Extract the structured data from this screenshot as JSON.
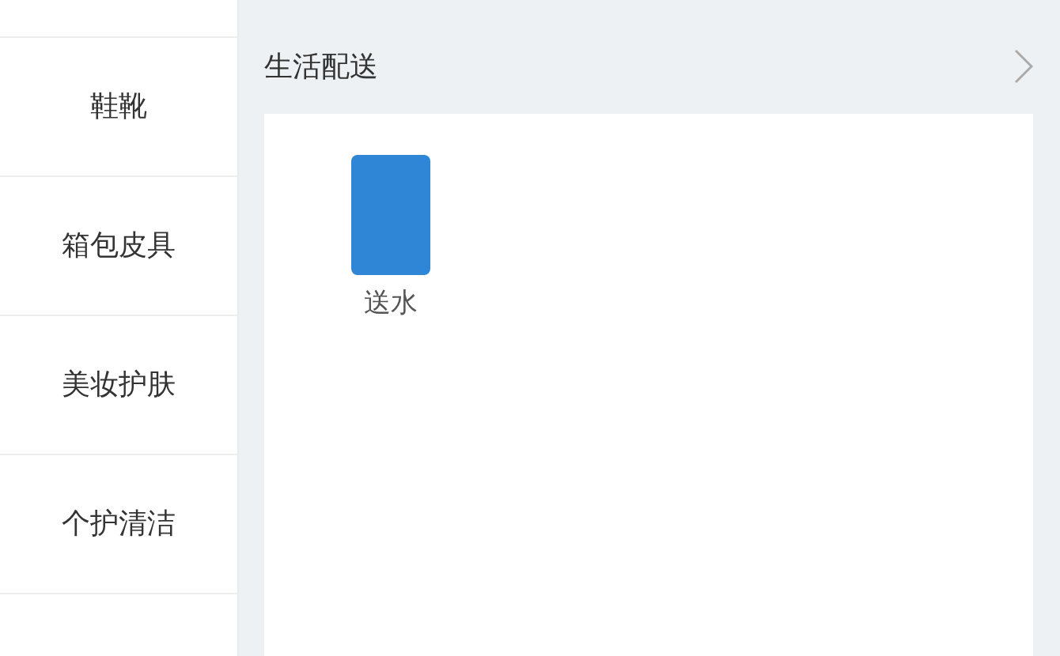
{
  "sidebar": {
    "items": [
      {
        "label": "鞋靴"
      },
      {
        "label": "箱包皮具"
      },
      {
        "label": "美妆护肤"
      },
      {
        "label": "个护清洁"
      }
    ]
  },
  "section": {
    "title": "生活配送",
    "items": [
      {
        "label": "送水"
      }
    ]
  }
}
